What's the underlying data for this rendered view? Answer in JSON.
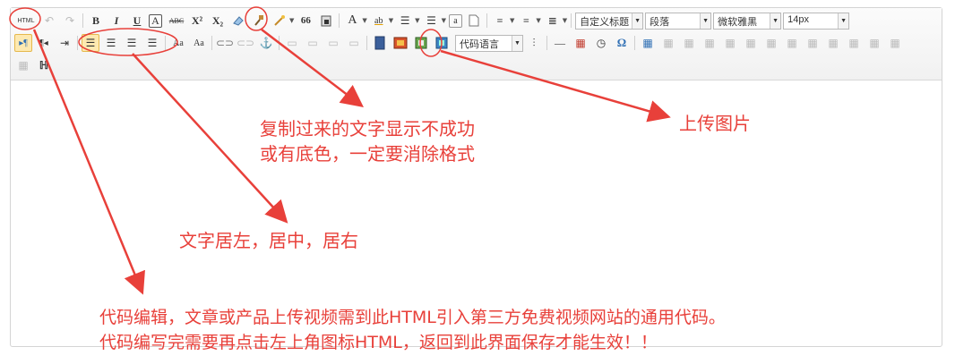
{
  "toolbar": {
    "html_label": "HTML",
    "bold": "B",
    "italic": "I",
    "underline": "U",
    "border_char": "A",
    "strike": "ABC",
    "superscript": "X²",
    "subscript": "X₂",
    "quote": "66",
    "fontcolor": "A",
    "backcolor": "ab",
    "custom_title": "自定义标题",
    "paragraph": "段落",
    "font_family": "微软雅黑",
    "font_size": "14px",
    "code_language": "代码语言",
    "omega": "Ω"
  },
  "annotations": {
    "clear_format_line1": "复制过来的文字显示不成功",
    "clear_format_line2": "或有底色，一定要消除格式",
    "upload_image": "上传图片",
    "alignment": "文字居左，居中，居右",
    "html_line1": "代码编辑，文章或产品上传视频需到此HTML引入第三方免费视频网站的通用代码。",
    "html_line2": "代码编写完需要再点击左上角图标HTML，返回到此界面保存才能生效！！"
  },
  "colors": {
    "annotation": "#e8403a",
    "accent": "#2f6fb4"
  }
}
